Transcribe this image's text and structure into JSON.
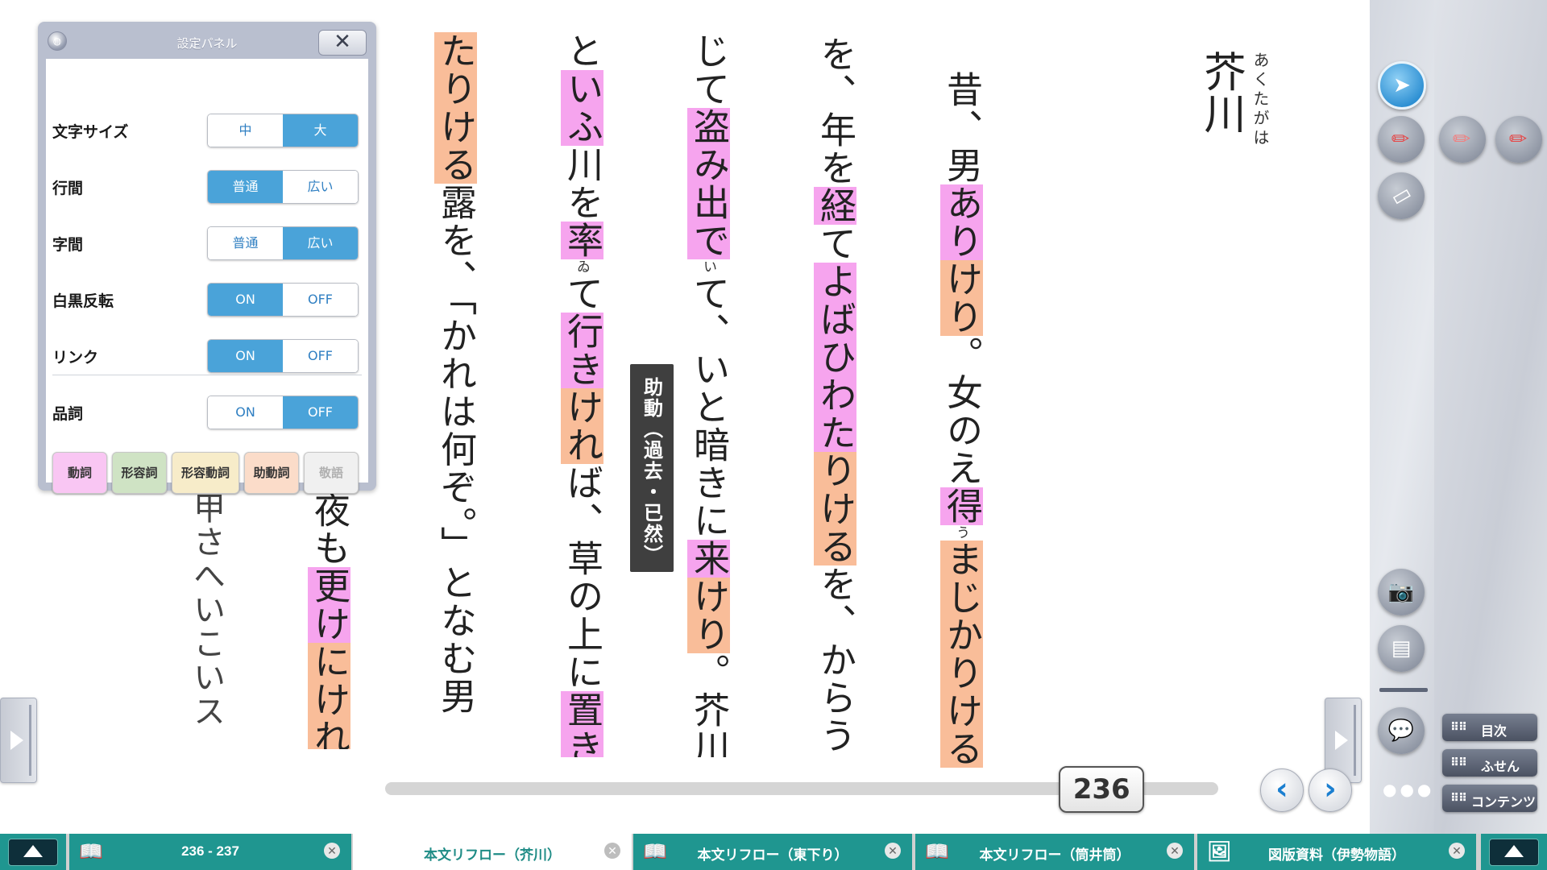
{
  "title": {
    "kanji": "芥川",
    "ruby": "あくたがは"
  },
  "columns": [
    [
      {
        "t": "昔、男"
      },
      {
        "t": "あり",
        "hl": "pink"
      },
      {
        "t": "けり",
        "hl": "peach"
      },
      {
        "t": "。女のえ"
      },
      {
        "t": "得",
        "hl": "pink",
        "ruby": "う"
      },
      {
        "t": "まじかりける",
        "hl": "peach"
      }
    ],
    [
      {
        "t": "を、年を"
      },
      {
        "t": "経",
        "hl": "pink"
      },
      {
        "t": "て"
      },
      {
        "t": "よばひわた",
        "hl": "pink"
      },
      {
        "t": "り",
        "hl": "peach"
      },
      {
        "t": "ける",
        "hl": "peach"
      },
      {
        "t": "を、からう"
      }
    ],
    [
      {
        "t": "じて"
      },
      {
        "t": "盗み出で",
        "hl": "pink",
        "ruby": "い"
      },
      {
        "t": "て、いと暗きに"
      },
      {
        "t": "来",
        "hl": "pink"
      },
      {
        "t": "けり",
        "hl": "peach"
      },
      {
        "t": "。芥川"
      }
    ],
    [
      {
        "t": "と"
      },
      {
        "t": "いふ",
        "hl": "pink"
      },
      {
        "t": "川を"
      },
      {
        "t": "率",
        "hl": "pink",
        "ruby": "ゐ"
      },
      {
        "t": "て"
      },
      {
        "t": "行き",
        "hl": "pink"
      },
      {
        "t": "けれ",
        "hl": "peach"
      },
      {
        "t": "ば、草の上に"
      },
      {
        "t": "置き",
        "hl": "pink"
      }
    ],
    [
      {
        "t": "たりける",
        "hl": "peach"
      },
      {
        "t": "露を、「かれは何ぞ。」となむ男"
      }
    ],
    [
      {
        "t": "夜も"
      },
      {
        "t": "更け",
        "hl": "pink"
      },
      {
        "t": "にけれ",
        "hl": "peach"
      }
    ],
    [
      {
        "t": "甲さへいこいス"
      }
    ]
  ],
  "tooltip": "助動（過去・已然）",
  "settings_panel": {
    "title": "設定パネル",
    "close_label": "✕",
    "rows": [
      {
        "label": "文字サイズ",
        "options": [
          "中",
          "大"
        ],
        "selected": 1
      },
      {
        "label": "行間",
        "options": [
          "普通",
          "広い"
        ],
        "selected": 0
      },
      {
        "label": "字間",
        "options": [
          "普通",
          "広い"
        ],
        "selected": 1
      },
      {
        "label": "白黒反転",
        "options": [
          "ON",
          "OFF"
        ],
        "selected": 0
      },
      {
        "label": "リンク",
        "options": [
          "ON",
          "OFF"
        ],
        "selected": 0
      },
      {
        "label": "品詞",
        "options": [
          "ON",
          "OFF"
        ],
        "selected": 1
      }
    ],
    "pos_buttons": [
      {
        "label": "動詞",
        "color": "#f9c6f3"
      },
      {
        "label": "形容詞",
        "color": "#cfe3c4"
      },
      {
        "label": "形容動詞",
        "color": "#f7ecc9"
      },
      {
        "label": "助動詞",
        "color": "#fbdcc9"
      },
      {
        "label": "敬語",
        "color": "#f0f0f0"
      }
    ]
  },
  "page": {
    "current": "236",
    "progress": 0.86
  },
  "toolbar": {
    "menu": [
      "目次",
      "ふせん",
      "コンテンツ"
    ]
  },
  "tabs": [
    {
      "label": "236 - 237",
      "icon": "book-icon"
    },
    {
      "label": "本文リフロー（芥川）",
      "icon": "",
      "active": true
    },
    {
      "label": "本文リフロー（東下り）",
      "icon": "book-search-icon"
    },
    {
      "label": "本文リフロー（筒井筒）",
      "icon": "book-search-icon"
    },
    {
      "label": "図版資料（伊勢物語）",
      "icon": "image-search-icon"
    }
  ],
  "colors": {
    "highlight_verb": "#f6a4ee",
    "highlight_aux": "#f9bd99",
    "tab_teal": "#1f9690",
    "toggle_blue": "#4aa3d9"
  }
}
